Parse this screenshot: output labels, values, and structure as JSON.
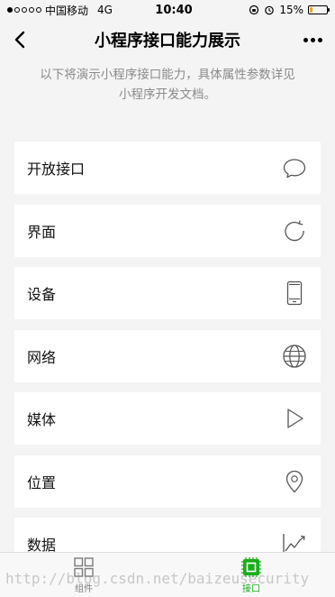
{
  "status_bar": {
    "carrier": "中国移动",
    "network": "4G",
    "time": "10:40",
    "battery": "15%",
    "battery_level": 0.15
  },
  "nav": {
    "title": "小程序接口能力展示"
  },
  "description": {
    "line1": "以下将演示小程序接口能力，具体属性参数详见",
    "line2": "小程序开发文档。"
  },
  "list": {
    "items": [
      {
        "label": "开放接口",
        "icon": "chat-bubble-icon"
      },
      {
        "label": "界面",
        "icon": "refresh-icon"
      },
      {
        "label": "设备",
        "icon": "phone-icon"
      },
      {
        "label": "网络",
        "icon": "globe-icon"
      },
      {
        "label": "媒体",
        "icon": "play-icon"
      },
      {
        "label": "位置",
        "icon": "location-pin-icon"
      },
      {
        "label": "数据",
        "icon": "chart-icon"
      }
    ]
  },
  "tabs": [
    {
      "label": "组件",
      "icon": "grid-icon",
      "active": false
    },
    {
      "label": "接口",
      "icon": "chip-icon",
      "active": true
    }
  ],
  "watermark": "http://blog.csdn.net/baizeusecurity",
  "colors": {
    "accent": "#1aad19",
    "background": "#f4f4f4",
    "battery": "#f5a623"
  }
}
